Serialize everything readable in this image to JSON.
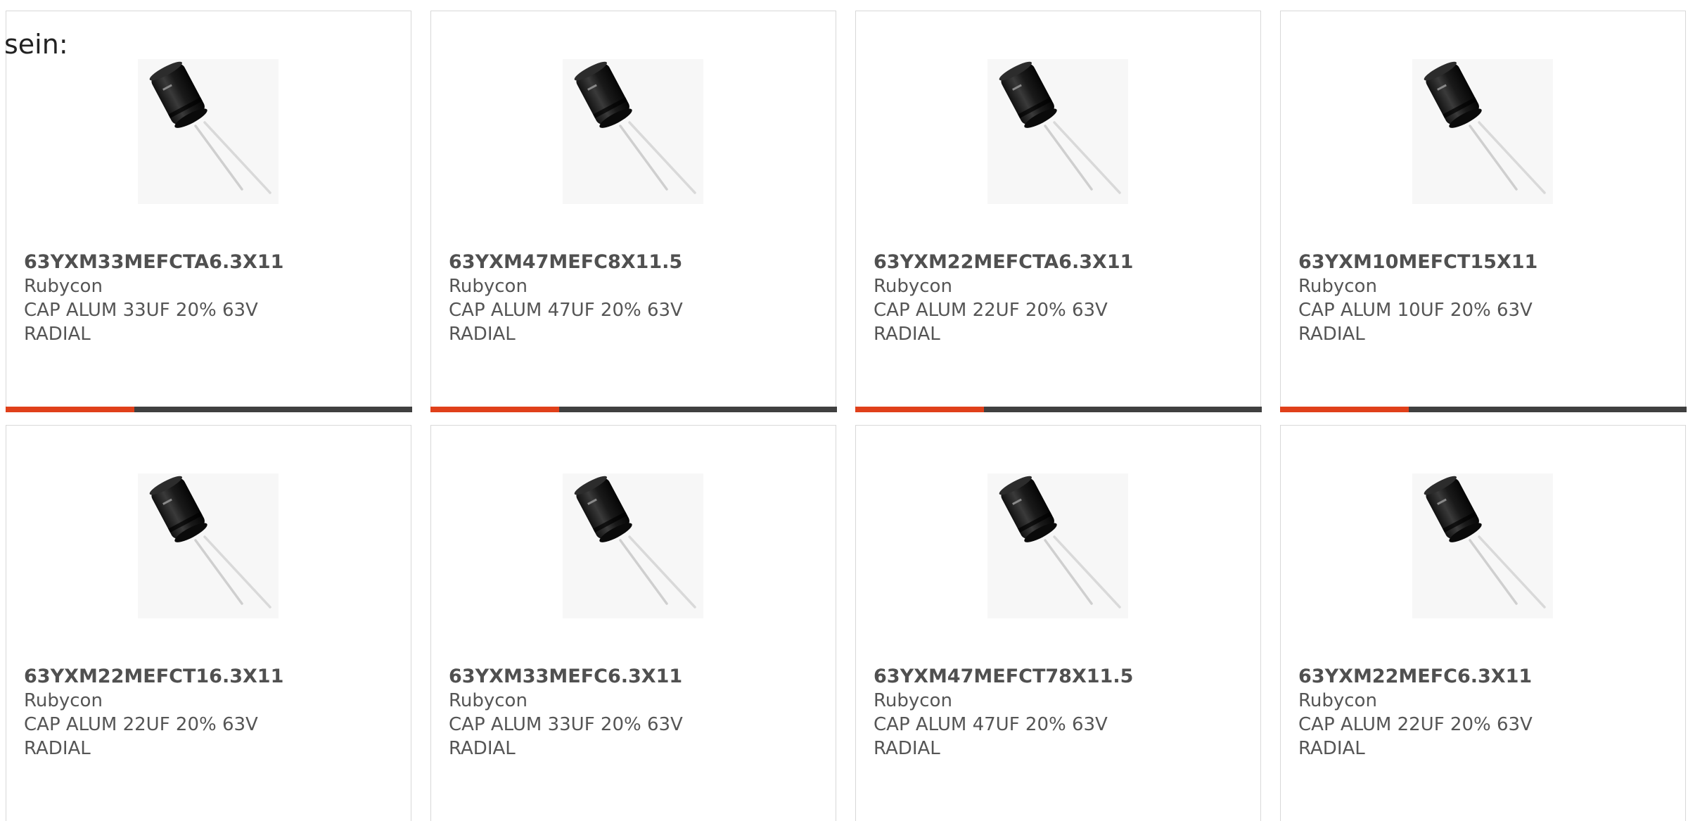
{
  "intro_text": "sein:",
  "colors": {
    "accent": "#e0401a",
    "bar_dark": "#404040",
    "card_border": "#d8d8d8"
  },
  "products": [
    {
      "part": "63YXM33MEFCTA6.3X11",
      "maker": "Rubycon",
      "desc_line1": "CAP ALUM 33UF 20% 63V",
      "desc_line2": "RADIAL",
      "image": "capacitor-image"
    },
    {
      "part": "63YXM47MEFC8X11.5",
      "maker": "Rubycon",
      "desc_line1": "CAP ALUM 47UF 20% 63V",
      "desc_line2": "RADIAL",
      "image": "capacitor-image"
    },
    {
      "part": "63YXM22MEFCTA6.3X11",
      "maker": "Rubycon",
      "desc_line1": "CAP ALUM 22UF 20% 63V",
      "desc_line2": "RADIAL",
      "image": "capacitor-image"
    },
    {
      "part": "63YXM10MEFCT15X11",
      "maker": "Rubycon",
      "desc_line1": "CAP ALUM 10UF 20% 63V",
      "desc_line2": "RADIAL",
      "image": "capacitor-image"
    },
    {
      "part": "63YXM22MEFCT16.3X11",
      "maker": "Rubycon",
      "desc_line1": "CAP ALUM 22UF 20% 63V",
      "desc_line2": "RADIAL",
      "image": "capacitor-image"
    },
    {
      "part": "63YXM33MEFC6.3X11",
      "maker": "Rubycon",
      "desc_line1": "CAP ALUM 33UF 20% 63V",
      "desc_line2": "RADIAL",
      "image": "capacitor-image"
    },
    {
      "part": "63YXM47MEFCT78X11.5",
      "maker": "Rubycon",
      "desc_line1": "CAP ALUM 47UF 20% 63V",
      "desc_line2": "RADIAL",
      "image": "capacitor-image"
    },
    {
      "part": "63YXM22MEFC6.3X11",
      "maker": "Rubycon",
      "desc_line1": "CAP ALUM 22UF 20% 63V",
      "desc_line2": "RADIAL",
      "image": "capacitor-image"
    }
  ]
}
